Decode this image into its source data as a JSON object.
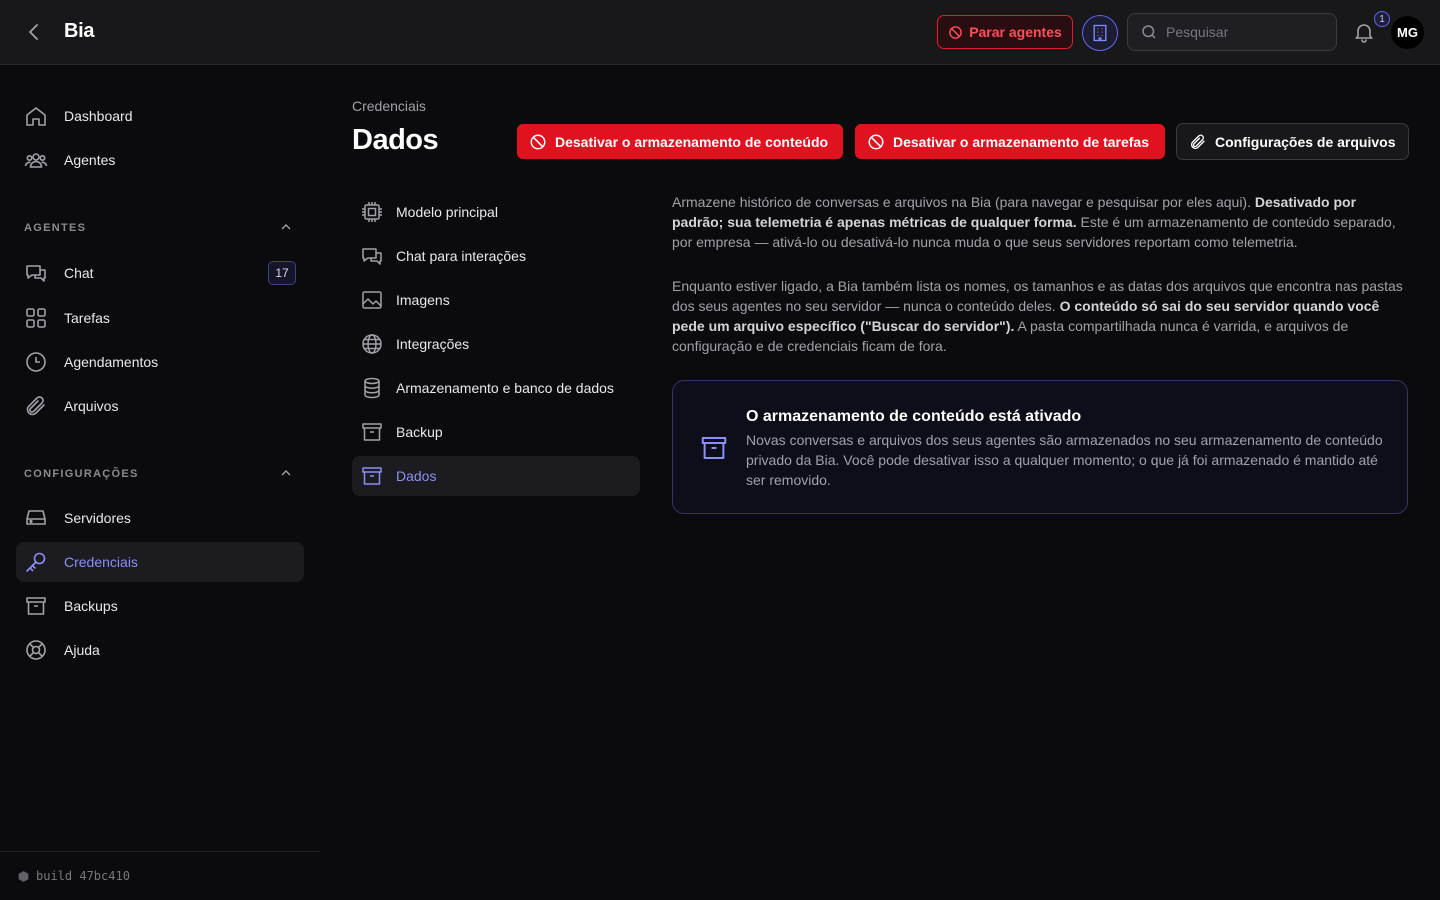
{
  "header": {
    "title": "Bia",
    "stop_agents_label": "Parar agentes",
    "search_placeholder": "Pesquisar",
    "notification_count": "1",
    "avatar_initials": "MG"
  },
  "sidebar": {
    "top_items": [
      {
        "label": "Dashboard",
        "icon": "home-icon"
      },
      {
        "label": "Agentes",
        "icon": "users-icon"
      }
    ],
    "agents_section": {
      "label": "AGENTES",
      "items": [
        {
          "label": "Chat",
          "icon": "chat-icon",
          "badge": "17"
        },
        {
          "label": "Tarefas",
          "icon": "grid-icon"
        },
        {
          "label": "Agendamentos",
          "icon": "clock-icon"
        },
        {
          "label": "Arquivos",
          "icon": "paperclip-icon"
        }
      ]
    },
    "settings_section": {
      "label": "CONFIGURAÇÕES",
      "items": [
        {
          "label": "Servidores",
          "icon": "server-icon"
        },
        {
          "label": "Credenciais",
          "icon": "key-icon",
          "active": true
        },
        {
          "label": "Backups",
          "icon": "archive-icon"
        },
        {
          "label": "Ajuda",
          "icon": "lifebuoy-icon"
        }
      ]
    },
    "footer": "build 47bc410"
  },
  "main": {
    "breadcrumb": "Credenciais",
    "title": "Dados",
    "actions": {
      "disable_content_storage": "Desativar o armazenamento de conteúdo",
      "disable_task_storage": "Desativar o armazenamento de tarefas",
      "file_settings": "Configurações de arquivos"
    },
    "subnav": [
      {
        "label": "Modelo principal",
        "icon": "cpu-icon"
      },
      {
        "label": "Chat para interações",
        "icon": "chat-icon"
      },
      {
        "label": "Imagens",
        "icon": "image-icon"
      },
      {
        "label": "Integrações",
        "icon": "globe-icon"
      },
      {
        "label": "Armazenamento e banco de dados",
        "icon": "database-icon"
      },
      {
        "label": "Backup",
        "icon": "archive-icon"
      },
      {
        "label": "Dados",
        "icon": "archive-icon",
        "active": true
      }
    ],
    "description": {
      "p1_text": "Armazene histórico de conversas e arquivos na Bia (para navegar e pesquisar por eles aqui). ",
      "p1_bold": "Desativado por padrão; sua telemetria é apenas métricas de qualquer forma.",
      "p1_tail": " Este é um armazenamento de conteúdo separado, por empresa — ativá-lo ou desativá-lo nunca muda o que seus servidores reportam como telemetria.",
      "p2_text": "Enquanto estiver ligado, a Bia também lista os nomes, os tamanhos e as datas dos arquivos que encontra nas pastas dos seus agentes no seu servidor — nunca o conteúdo deles. ",
      "p2_bold": "O conteúdo só sai do seu servidor quando você pede um arquivo específico (\"Buscar do servidor\").",
      "p2_tail": " A pasta compartilhada nunca é varrida, e arquivos de configuração e de credenciais ficam de fora."
    },
    "status_card": {
      "title": "O armazenamento de conteúdo está ativado",
      "body": "Novas conversas e arquivos dos seus agentes são armazenados no seu armazenamento de conteúdo privado da Bia. Você pode desativar isso a qualquer momento; o que já foi armazenado é mantido até ser removido."
    }
  },
  "colors": {
    "accent": "#8b8ff6",
    "danger": "#e1121f",
    "background": "#0b0b0d",
    "topbar": "#18181b"
  }
}
